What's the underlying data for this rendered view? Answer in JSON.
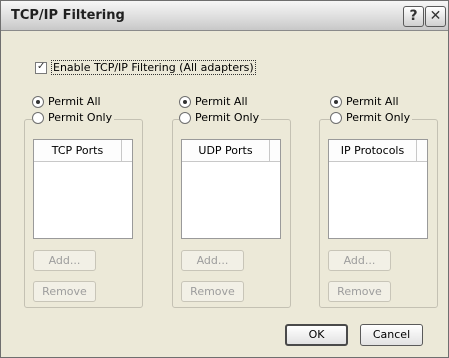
{
  "dialog": {
    "title": "TCP/IP Filtering",
    "help_glyph": "?",
    "close_glyph": "✕"
  },
  "enable": {
    "label": "Enable TCP/IP Filtering (All adapters)",
    "checked": true
  },
  "groups": [
    {
      "permit_all": "Permit All",
      "permit_only": "Permit Only",
      "selected": "permit_all",
      "list_header": "TCP Ports",
      "add_label": "Add...",
      "remove_label": "Remove"
    },
    {
      "permit_all": "Permit All",
      "permit_only": "Permit Only",
      "selected": "permit_all",
      "list_header": "UDP Ports",
      "add_label": "Add...",
      "remove_label": "Remove"
    },
    {
      "permit_all": "Permit All",
      "permit_only": "Permit Only",
      "selected": "permit_all",
      "list_header": "IP Protocols",
      "add_label": "Add...",
      "remove_label": "Remove"
    }
  ],
  "footer": {
    "ok_label": "OK",
    "cancel_label": "Cancel"
  }
}
